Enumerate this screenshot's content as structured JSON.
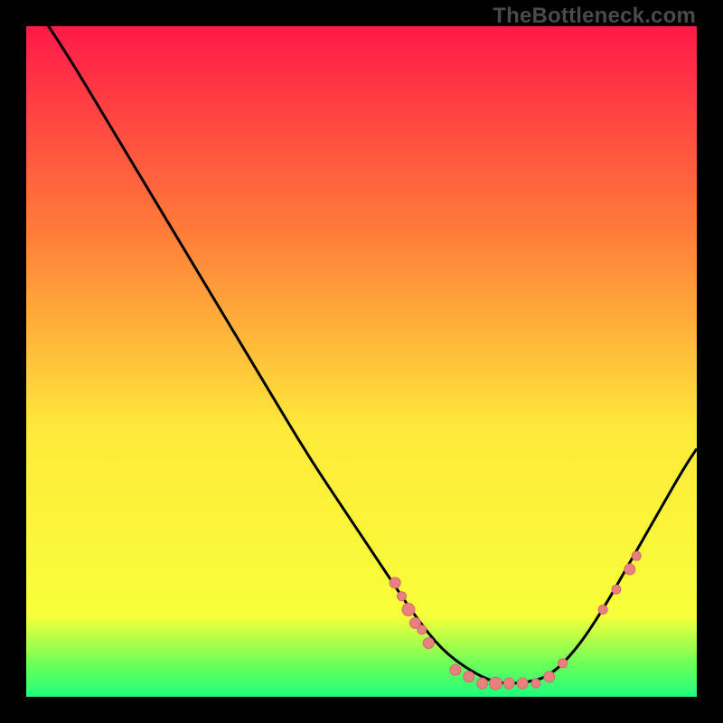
{
  "watermark": "TheBottleneck.com",
  "colors": {
    "gradient_top": "#ff1a49",
    "gradient_mid1": "#ff7a3a",
    "gradient_mid2": "#ffe93a",
    "gradient_bottom1": "#f7ff3a",
    "gradient_green1": "#6eff59",
    "gradient_green2": "#1fff7d",
    "curve": "#000000",
    "marker_fill": "#e98080",
    "marker_stroke": "#d46a6a"
  },
  "chart_data": {
    "type": "line",
    "title": "",
    "xlabel": "",
    "ylabel": "",
    "xlim": [
      0,
      100
    ],
    "ylim": [
      0,
      100
    ],
    "grid": false,
    "legend": false,
    "series": [
      {
        "name": "bottleneck-curve",
        "x": [
          0,
          6,
          12,
          18,
          24,
          30,
          36,
          42,
          48,
          54,
          58,
          62,
          66,
          70,
          74,
          78,
          82,
          86,
          90,
          94,
          98,
          100
        ],
        "y": [
          105,
          96,
          86,
          76,
          66,
          56,
          46,
          36,
          27,
          18,
          12,
          7,
          4,
          2,
          2,
          3,
          7,
          13,
          20,
          27,
          34,
          37
        ]
      }
    ],
    "markers": [
      {
        "x": 55,
        "y": 17,
        "r": 6
      },
      {
        "x": 56,
        "y": 15,
        "r": 5
      },
      {
        "x": 57,
        "y": 13,
        "r": 7
      },
      {
        "x": 58,
        "y": 11,
        "r": 6
      },
      {
        "x": 59,
        "y": 10,
        "r": 5
      },
      {
        "x": 60,
        "y": 8,
        "r": 6
      },
      {
        "x": 64,
        "y": 4,
        "r": 6
      },
      {
        "x": 66,
        "y": 3,
        "r": 6
      },
      {
        "x": 68,
        "y": 2,
        "r": 6
      },
      {
        "x": 70,
        "y": 2,
        "r": 7
      },
      {
        "x": 72,
        "y": 2,
        "r": 6
      },
      {
        "x": 74,
        "y": 2,
        "r": 6
      },
      {
        "x": 76,
        "y": 2,
        "r": 5
      },
      {
        "x": 78,
        "y": 3,
        "r": 6
      },
      {
        "x": 80,
        "y": 5,
        "r": 5
      },
      {
        "x": 86,
        "y": 13,
        "r": 5
      },
      {
        "x": 88,
        "y": 16,
        "r": 5
      },
      {
        "x": 90,
        "y": 19,
        "r": 6
      },
      {
        "x": 91,
        "y": 21,
        "r": 5
      }
    ]
  }
}
